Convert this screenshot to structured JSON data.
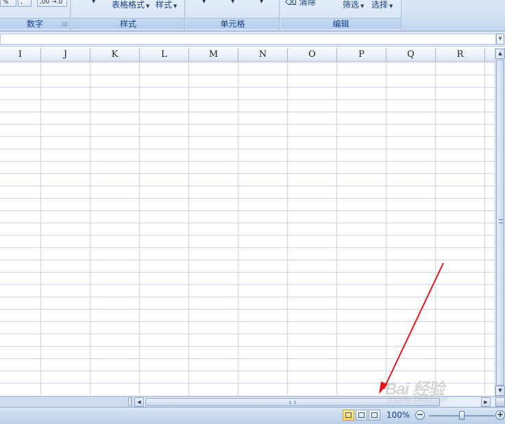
{
  "ribbon": {
    "groups": [
      {
        "label": "数字"
      },
      {
        "label": "样式"
      },
      {
        "label": "单元格"
      },
      {
        "label": "编辑"
      }
    ],
    "number": {
      "percent_label": "%",
      "comma_label": ",",
      "decimal_label": ".00 →.0"
    },
    "styles": {
      "table_format_label": "表格格式",
      "cell_styles_label": "样式"
    },
    "editing": {
      "clear_label": "清除",
      "filter_label": "筛选",
      "select_label": "选择"
    }
  },
  "columns": [
    "I",
    "J",
    "K",
    "L",
    "M",
    "N",
    "O",
    "P",
    "Q",
    "R"
  ],
  "status_bar": {
    "zoom": "100%",
    "zoom_percent": 100
  },
  "watermark": {
    "logo": "Bai 经验",
    "url": "jingyan.baidu.com"
  },
  "colors": {
    "annotation_arrow": "#e8141c",
    "grid_line": "#d0d7e5",
    "ribbon_text": "#15428b"
  }
}
